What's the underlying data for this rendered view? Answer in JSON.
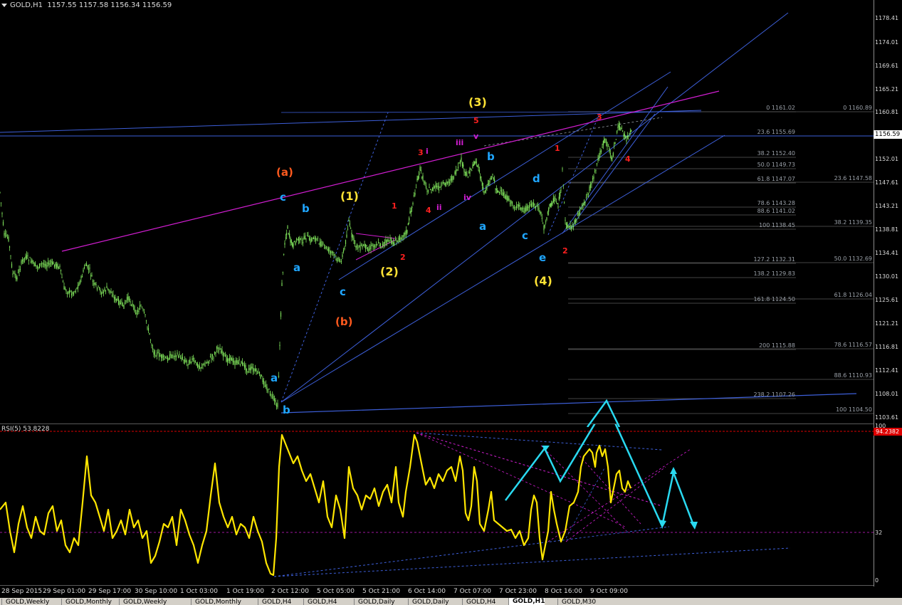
{
  "header": {
    "symbol": "GOLD,H1",
    "values": "1157.55 1157.58 1156.34 1156.59"
  },
  "current_price": "1156.59",
  "rsi": {
    "label": "RSI(5) 53.8228",
    "level_high": "94.2382",
    "level_low": "32",
    "axis_top": "100",
    "axis_bottom": "0"
  },
  "price_axis": [
    "1178.41",
    "1174.01",
    "1169.61",
    "1165.21",
    "1160.81",
    "1156.59",
    "1152.01",
    "1147.61",
    "1143.21",
    "1138.81",
    "1134.41",
    "1130.01",
    "1125.61",
    "1121.21",
    "1116.81",
    "1112.41",
    "1108.01",
    "1103.61"
  ],
  "time_axis": [
    "28 Sep 2015",
    "29 Sep 01:00",
    "29 Sep 17:00",
    "30 Sep 10:00",
    "1 Oct 03:00",
    "1 Oct 19:00",
    "2 Oct 12:00",
    "5 Oct 05:00",
    "5 Oct 21:00",
    "6 Oct 14:00",
    "7 Oct 07:00",
    "7 Oct 23:00",
    "8 Oct 16:00",
    "9 Oct 09:00"
  ],
  "fib_left": [
    "0 1161.02",
    "23.6 1155.69",
    "38.2 1152.40",
    "50.0 1149.73",
    "61.8 1147.07",
    "78.6 1143.28",
    "88.6 1141.02",
    "100 1138.45",
    "127.2 1132.31",
    "138.2 1129.83",
    "161.8 1124.50",
    "200 1115.88",
    "238.2 1107.26"
  ],
  "fib_right": [
    "0 1160.89",
    "23.6 1147.58",
    "38.2 1139.35",
    "50.0 1132.69",
    "61.8 1126.04",
    "78.6 1116.57",
    "88.6 1110.93",
    "100 1104.50"
  ],
  "waves": [
    {
      "id": "wave-a-paren",
      "text": "(a)",
      "color": "#ff5a1e"
    },
    {
      "id": "wave-b-paren",
      "text": "(b)",
      "color": "#ff5a1e"
    },
    {
      "id": "wave-1-paren",
      "text": "(1)",
      "color": "#ffe234"
    },
    {
      "id": "wave-2-paren",
      "text": "(2)",
      "color": "#ffe234"
    },
    {
      "id": "wave-3-paren",
      "text": "(3)",
      "color": "#ffe234"
    },
    {
      "id": "wave-4-paren",
      "text": "(4)",
      "color": "#ffe234"
    },
    {
      "id": "wave-c-blue-1",
      "text": "c",
      "color": "#1fa6ff"
    },
    {
      "id": "wave-b-blue-1",
      "text": "b",
      "color": "#1fa6ff"
    },
    {
      "id": "wave-a-blue-1",
      "text": "a",
      "color": "#1fa6ff"
    },
    {
      "id": "wave-a-blue-2",
      "text": "a",
      "color": "#1fa6ff"
    },
    {
      "id": "wave-b-blue-2",
      "text": "b",
      "color": "#1fa6ff"
    },
    {
      "id": "wave-c-blue-2",
      "text": "c",
      "color": "#1fa6ff"
    },
    {
      "id": "wave-a-blue-3",
      "text": "a",
      "color": "#1fa6ff"
    },
    {
      "id": "wave-b-blue-3",
      "text": "b",
      "color": "#1fa6ff"
    },
    {
      "id": "wave-c-blue-3",
      "text": "c",
      "color": "#1fa6ff"
    },
    {
      "id": "wave-d-blue",
      "text": "d",
      "color": "#1fa6ff"
    },
    {
      "id": "wave-e-blue",
      "text": "e",
      "color": "#1fa6ff"
    },
    {
      "id": "wave-1-red-a",
      "text": "1",
      "color": "#ff2020"
    },
    {
      "id": "wave-2-red-a",
      "text": "2",
      "color": "#ff2020"
    },
    {
      "id": "wave-3-red-a",
      "text": "3",
      "color": "#ff2020"
    },
    {
      "id": "wave-4-red-a",
      "text": "4",
      "color": "#ff2020"
    },
    {
      "id": "wave-5-red-a",
      "text": "5",
      "color": "#ff2020"
    },
    {
      "id": "wave-1-red-b",
      "text": "1",
      "color": "#ff2020"
    },
    {
      "id": "wave-2-red-b",
      "text": "2",
      "color": "#ff2020"
    },
    {
      "id": "wave-3-red-b",
      "text": "3",
      "color": "#ff2020"
    },
    {
      "id": "wave-4-red-b",
      "text": "4",
      "color": "#ff2020"
    },
    {
      "id": "wave-i",
      "text": "i",
      "color": "#d21ed2"
    },
    {
      "id": "wave-ii",
      "text": "ii",
      "color": "#d21ed2"
    },
    {
      "id": "wave-iii",
      "text": "iii",
      "color": "#d21ed2"
    },
    {
      "id": "wave-iv",
      "text": "iv",
      "color": "#d21ed2"
    },
    {
      "id": "wave-v",
      "text": "v",
      "color": "#d21ed2"
    }
  ],
  "tabs": [
    "GOLD,Weekly",
    "GOLD,Monthly",
    "GOLD,Weekly",
    "GOLD,Monthly",
    "GOLD,H4",
    "GOLD,H4",
    "GOLD,Daily",
    "GOLD,Daily",
    "GOLD,H4",
    "GOLD,H1",
    "GOLD,M30"
  ],
  "active_tab": 9,
  "colors": {
    "candle": "#7ee05a",
    "trendline": "#3d5fd9",
    "magenta": "#d21ed2",
    "rsi": "#ffe600",
    "arrow": "#29d9f0",
    "fib": "#6e6e6e"
  }
}
